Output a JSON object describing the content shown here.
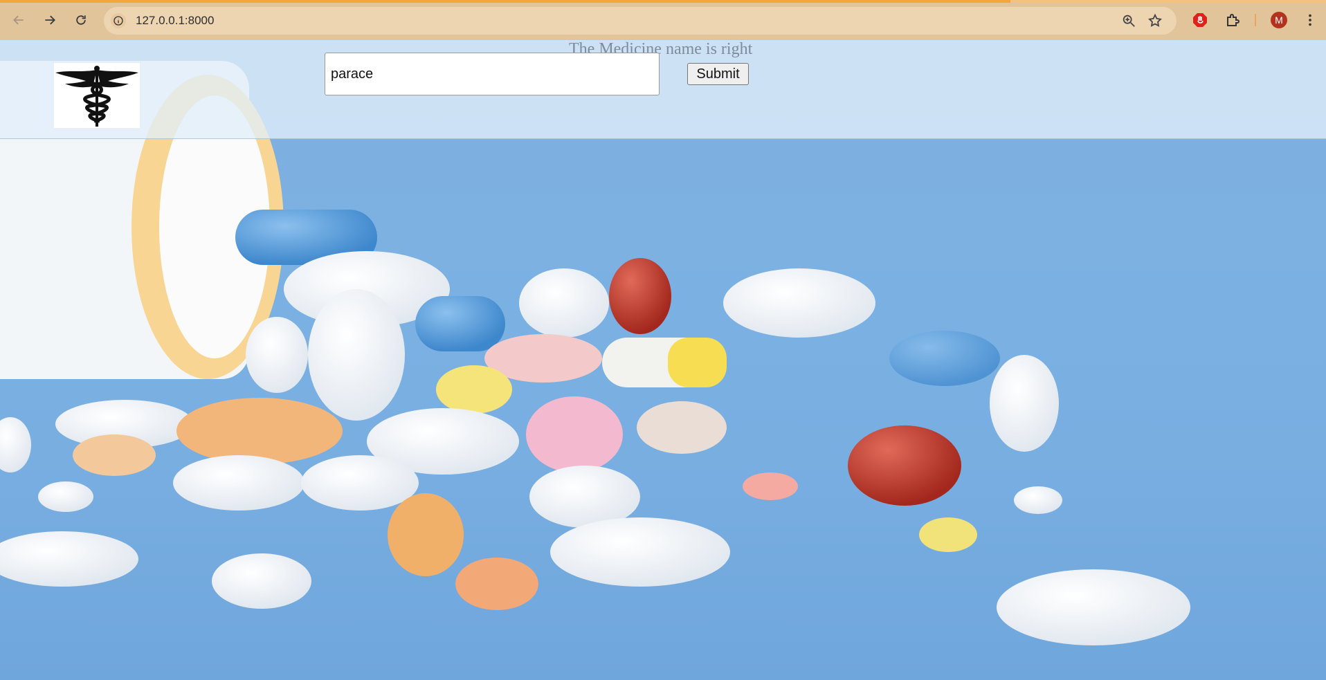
{
  "browser": {
    "url": "127.0.0.1:8000",
    "avatar_initial": "M"
  },
  "page": {
    "status_message": "The Medicine name is right",
    "search": {
      "value": "parace"
    },
    "submit_label": "Submit"
  },
  "colors": {
    "chrome": "#e2c49b",
    "omnibox": "#eed5b2",
    "background": "#7fb3df",
    "avatar": "#b3331f"
  }
}
